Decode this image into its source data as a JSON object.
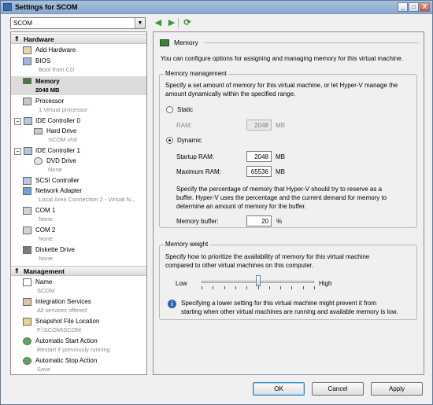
{
  "window": {
    "title": "Settings for SCOM",
    "buttons": {
      "minimize": "_",
      "maximize": "□",
      "close": "X"
    }
  },
  "toolbar": {
    "vm_select": "SCOM",
    "back_icon": "back-arrow-icon",
    "forward_icon": "forward-arrow-icon",
    "refresh_icon": "refresh-icon"
  },
  "sidebar": {
    "hardware": {
      "header": "Hardware",
      "items": [
        {
          "name": "Add Hardware",
          "sub": ""
        },
        {
          "name": "BIOS",
          "sub": "Boot from CD"
        },
        {
          "name": "Memory",
          "sub": "2048 MB",
          "selected": true
        },
        {
          "name": "Processor",
          "sub": "1 Virtual processor"
        },
        {
          "name": "IDE Controller 0",
          "sub": ""
        },
        {
          "name": "Hard Drive",
          "sub": "SCOM.vhd"
        },
        {
          "name": "IDE Controller 1",
          "sub": ""
        },
        {
          "name": "DVD Drive",
          "sub": "None"
        },
        {
          "name": "SCSI Controller",
          "sub": ""
        },
        {
          "name": "Network Adapter",
          "sub": "Local Area Connection 2 - Virtual N..."
        },
        {
          "name": "COM 1",
          "sub": "None"
        },
        {
          "name": "COM 2",
          "sub": "None"
        },
        {
          "name": "Diskette Drive",
          "sub": "None"
        }
      ]
    },
    "management": {
      "header": "Management",
      "items": [
        {
          "name": "Name",
          "sub": "SCOM"
        },
        {
          "name": "Integration Services",
          "sub": "All services offered"
        },
        {
          "name": "Snapshot File Location",
          "sub": "F:\\SCOM\\SCOM"
        },
        {
          "name": "Automatic Start Action",
          "sub": "Restart if previously running"
        },
        {
          "name": "Automatic Stop Action",
          "sub": "Save"
        }
      ]
    }
  },
  "memory_page": {
    "header": "Memory",
    "description": "You can configure options for assigning and managing memory for this virtual machine.",
    "management": {
      "title": "Memory management",
      "description_line1": "Specify a set amount of memory for this virtual machine, or let Hyper-V manage the",
      "description_line2": "amount dynamically within the specified range.",
      "static_label": "Static",
      "ram_label": "RAM:",
      "ram_value": "2048",
      "ram_unit": "MB",
      "dynamic_label": "Dynamic",
      "selected_mode": "Dynamic",
      "startup_label": "Startup RAM:",
      "startup_value": "2048",
      "startup_unit": "MB",
      "max_label": "Maximum RAM:",
      "max_value": "65536",
      "max_unit": "MB",
      "buffer_desc_line1": "Specify the percentage of memory that Hyper-V should try to reserve as a",
      "buffer_desc_line2": "buffer. Hyper-V uses the percentage and the current demand for memory to",
      "buffer_desc_line3": "determine an amount of memory for the buffer.",
      "buffer_label": "Memory buffer:",
      "buffer_value": "20",
      "buffer_unit": "%"
    },
    "weight": {
      "title": "Memory weight",
      "description_line1": "Specify how to prioritize the availability of memory for this virtual machine",
      "description_line2": "compared to other virtual machines on this computer.",
      "low_label": "Low",
      "high_label": "High",
      "slider_level": 0.5,
      "info_line1": "Specifying a lower setting for this virtual machine might prevent it from",
      "info_line2": "starting when other virtual machines are running and available memory is low."
    }
  },
  "footer": {
    "ok": "OK",
    "cancel": "Cancel",
    "apply": "Apply"
  }
}
